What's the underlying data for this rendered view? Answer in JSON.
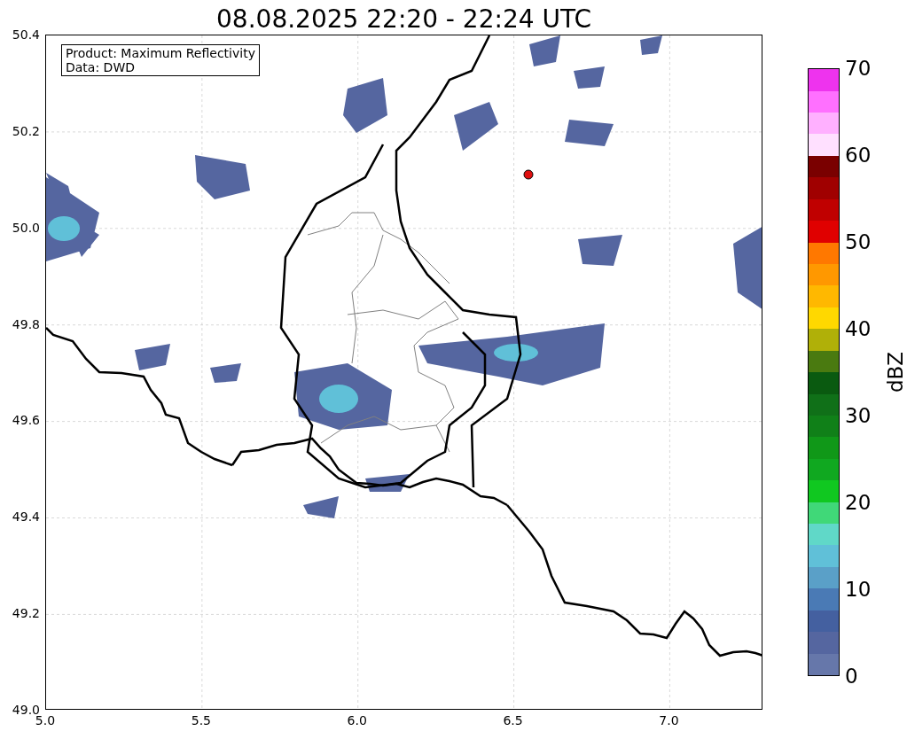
{
  "title": "08.08.2025 22:20 - 22:24 UTC",
  "plot": {
    "info_box": [
      "Product: Maximum Reflectivity",
      "Data: DWD"
    ],
    "x_ticks": [
      "5.0",
      "5.5",
      "6.0",
      "6.5",
      "7.0"
    ],
    "y_ticks": [
      "50.4",
      "50.2",
      "50.0",
      "49.8",
      "49.6",
      "49.4",
      "49.2",
      "49.0"
    ]
  },
  "colorbar": {
    "label": "dBZ",
    "ticks": [
      "70",
      "60",
      "50",
      "40",
      "30",
      "20",
      "10",
      "0"
    ]
  }
}
